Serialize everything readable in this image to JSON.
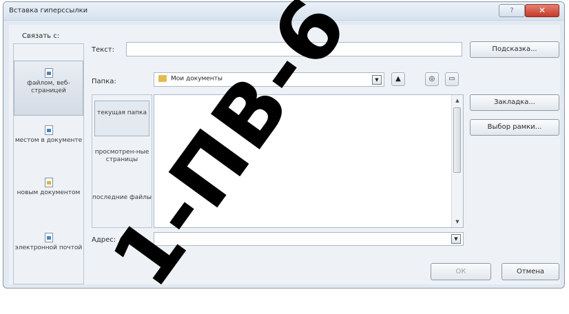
{
  "window": {
    "title": "Вставка гиперссылки",
    "help_glyph": "?",
    "close_glyph": "✕"
  },
  "link_to": {
    "label": "Связать с:",
    "items": [
      {
        "label": "файлом, веб-страницей",
        "icon": "web-page-icon"
      },
      {
        "label": "местом в документе",
        "icon": "place-in-document-icon"
      },
      {
        "label": "новым документом",
        "icon": "new-document-icon"
      },
      {
        "label": "электронной почтой",
        "icon": "email-icon"
      }
    ]
  },
  "text_field": {
    "label": "Текст:",
    "value": ""
  },
  "folder_field": {
    "label": "Папка:",
    "value": "Мои документы"
  },
  "browse_nav": {
    "items": [
      {
        "label": "текущая папка"
      },
      {
        "label": "просмотрен-ные страницы"
      },
      {
        "label": "последние файлы"
      }
    ]
  },
  "address_field": {
    "label": "Адрес:",
    "value": ""
  },
  "buttons": {
    "hint": "Подсказка...",
    "bookmark": "Закладка...",
    "frame": "Выбор рамки...",
    "ok": "ОК",
    "cancel": "Отмена"
  },
  "watermark": "1-ПВ-6",
  "colors": {
    "window_bg": "#e3e9f1",
    "close_red": "#c3392a",
    "folder_yellow": "#e3bb4d"
  }
}
